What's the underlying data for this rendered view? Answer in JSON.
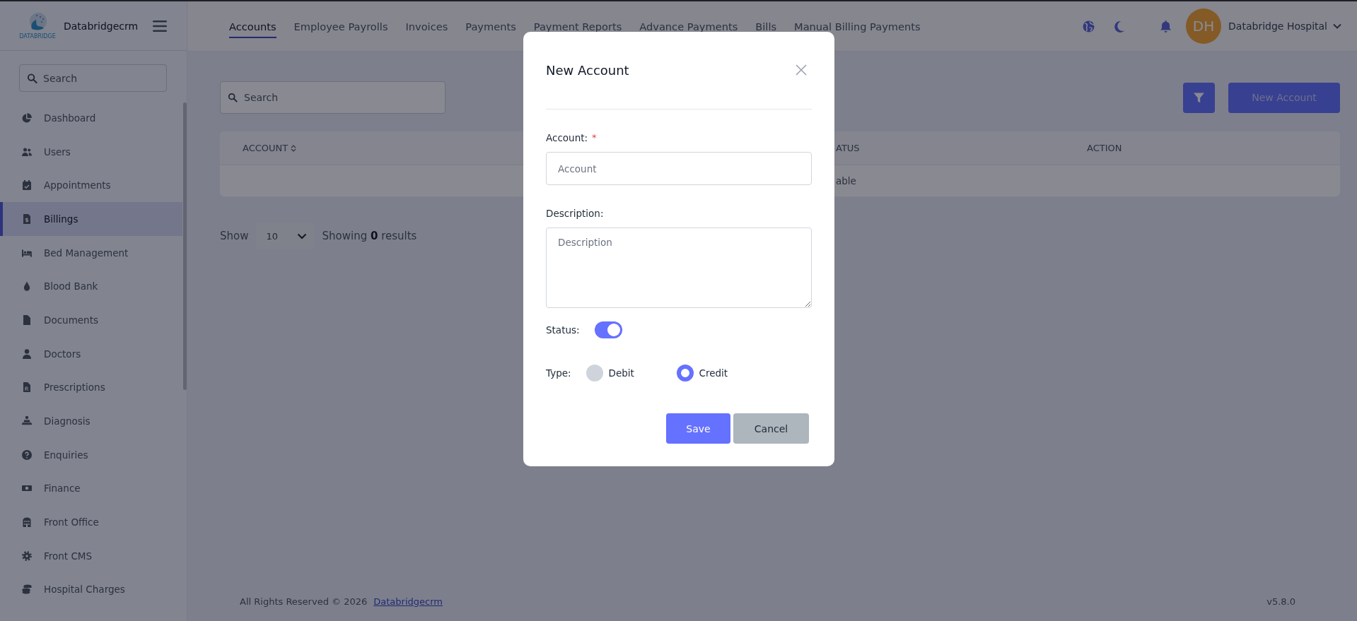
{
  "sidebar": {
    "brand": "Databridgecrm",
    "logo_caption": "DATABRIDGE",
    "search": {
      "placeholder": "Search"
    },
    "items": [
      {
        "label": "Dashboard",
        "selected": false
      },
      {
        "label": "Users",
        "selected": false
      },
      {
        "label": "Appointments",
        "selected": false
      },
      {
        "label": "Billings",
        "selected": true
      },
      {
        "label": "Bed Management",
        "selected": false
      },
      {
        "label": "Blood Bank",
        "selected": false
      },
      {
        "label": "Documents",
        "selected": false
      },
      {
        "label": "Doctors",
        "selected": false
      },
      {
        "label": "Prescriptions",
        "selected": false
      },
      {
        "label": "Diagnosis",
        "selected": false
      },
      {
        "label": "Enquiries",
        "selected": false
      },
      {
        "label": "Finance",
        "selected": false
      },
      {
        "label": "Front Office",
        "selected": false
      },
      {
        "label": "Front CMS",
        "selected": false
      },
      {
        "label": "Hospital Charges",
        "selected": false
      }
    ]
  },
  "top_nav": {
    "tabs": [
      {
        "label": "Accounts",
        "selected": true
      },
      {
        "label": "Employee Payrolls",
        "selected": false
      },
      {
        "label": "Invoices",
        "selected": false
      },
      {
        "label": "Payments",
        "selected": false
      },
      {
        "label": "Payment Reports",
        "selected": false
      },
      {
        "label": "Advance Payments",
        "selected": false
      },
      {
        "label": "Bills",
        "selected": false
      },
      {
        "label": "Manual Billing Payments",
        "selected": false
      }
    ],
    "user": {
      "initials": "DH",
      "name": "Databridge Hospital"
    }
  },
  "toolbar": {
    "search": {
      "placeholder": "Search"
    },
    "new_button": "New Account"
  },
  "table": {
    "columns": [
      {
        "label": "ACCOUNT",
        "sortable": true
      },
      {
        "label": "ATUS",
        "sortable": false
      },
      {
        "label": "ACTION",
        "sortable": false
      }
    ],
    "empty_message": "able"
  },
  "pagination": {
    "show_label": "Show",
    "page_size": "10",
    "summary": "Showing **0** results"
  },
  "footer": {
    "copyright": "All Rights Reserved © 2026",
    "link": "Databridgecrm",
    "version": "v5.8.0"
  },
  "modal": {
    "title": "New Account",
    "fields": [
      {
        "kind": "input",
        "label": "Account:",
        "required_mark": "*",
        "placeholder": "Account"
      },
      {
        "kind": "textarea",
        "label": "Description:",
        "placeholder": "Description"
      }
    ],
    "status": {
      "label": "Status:",
      "on": true
    },
    "type": {
      "label": "Type:",
      "options": [
        {
          "label": "Debit",
          "selected": false
        },
        {
          "label": "Credit",
          "selected": true
        }
      ]
    },
    "buttons": [
      {
        "kind": "primary",
        "label": "Save"
      },
      {
        "kind": "secondary",
        "label": "Cancel"
      }
    ]
  }
}
